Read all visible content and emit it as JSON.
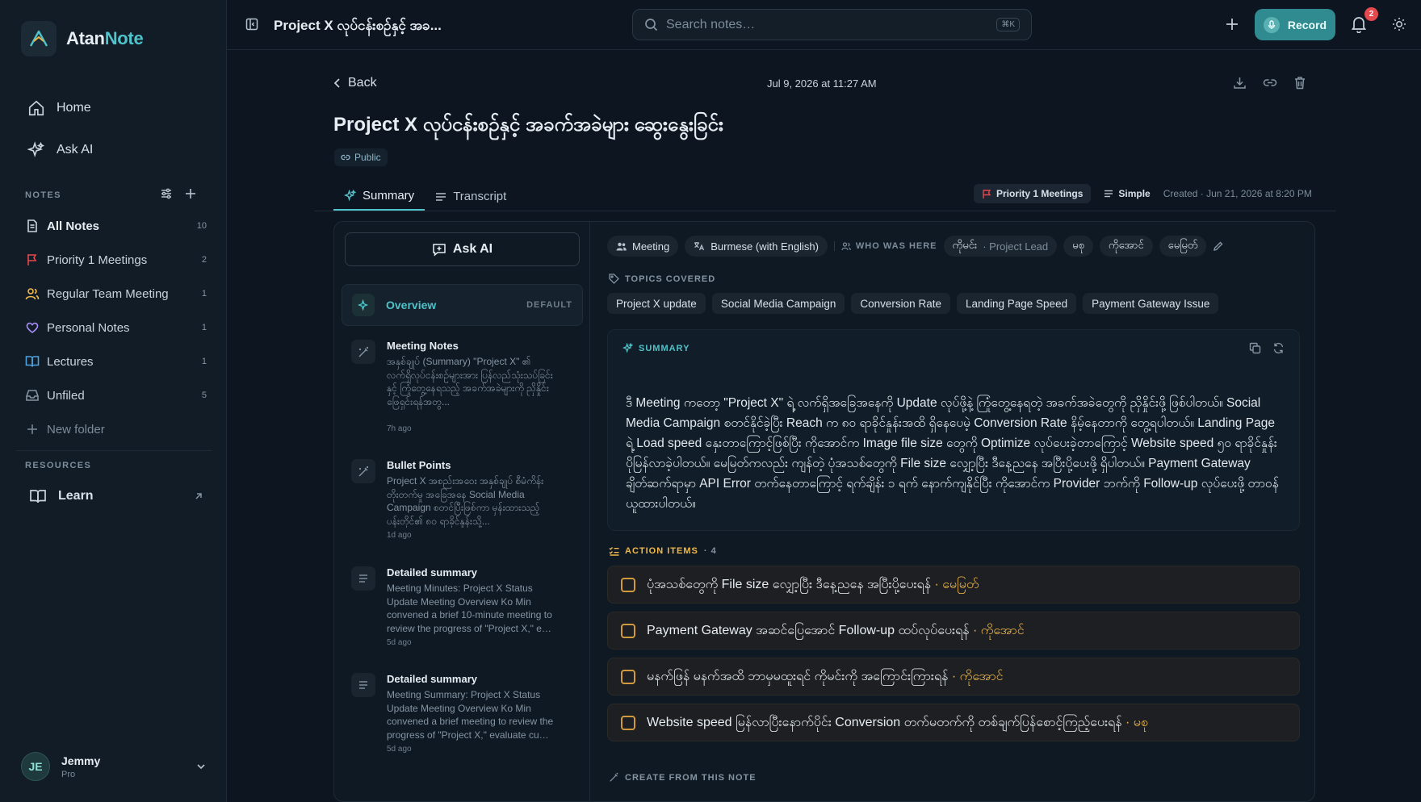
{
  "app": {
    "name_part1": "Atan",
    "name_part2": "Note"
  },
  "sidebar": {
    "nav": [
      {
        "label": "Home",
        "icon": "home-icon"
      },
      {
        "label": "Ask AI",
        "icon": "sparkle-icon"
      }
    ],
    "notes_label": "NOTES",
    "notes": [
      {
        "label": "All Notes",
        "count": "10",
        "icon": "document-icon",
        "color": "#c9d3dc"
      },
      {
        "label": "Priority 1 Meetings",
        "count": "2",
        "icon": "flag-icon",
        "color": "#e5484d"
      },
      {
        "label": "Regular Team Meeting",
        "count": "1",
        "icon": "users-icon",
        "color": "#f0b84a"
      },
      {
        "label": "Personal Notes",
        "count": "1",
        "icon": "heart-icon",
        "color": "#a78bfa"
      },
      {
        "label": "Lectures",
        "count": "1",
        "icon": "book-icon",
        "color": "#4fa3e0"
      },
      {
        "label": "Unfiled",
        "count": "5",
        "icon": "inbox-icon",
        "color": "#8594a3"
      }
    ],
    "new_folder": "New folder",
    "resources_label": "RESOURCES",
    "learn": "Learn",
    "user": {
      "initials": "JE",
      "name": "Jemmy",
      "plan": "Pro"
    }
  },
  "topbar": {
    "title": "Project X လုပ်ငန်းစဉ်နှင့် အခ...",
    "search_placeholder": "Search notes…",
    "search_shortcut": "⌘K",
    "record_label": "Record",
    "notifications_count": "2"
  },
  "note": {
    "back": "Back",
    "date": "Jul 9, 2026 at 11:27 AM",
    "title": "Project X လုပ်ငန်းစဉ်နှင့် အခက်အခဲများ ဆွေးနွေးခြင်း",
    "visibility": "Public",
    "tabs": [
      "Summary",
      "Transcript"
    ],
    "folder": "Priority 1 Meetings",
    "mode": "Simple",
    "created": "Created · Jun 21, 2026 at 8:20 PM"
  },
  "templates": {
    "ask_ai": "Ask AI",
    "overview": {
      "label": "Overview",
      "tag": "DEFAULT"
    },
    "items": [
      {
        "title": "Meeting Notes",
        "desc": "အနှစ်ချုပ် (Summary) \"Project X\" ၏ လက်ရှိလုပ်ငန်းစဉ်များအား ပြန်လည်သုံးသပ်ခြင်းနှင့် ကြုံတွေ့နေရသည့် အခက်အခဲများကို ညှိနှိုင်းဖြေရှင်းရန်အတွ...",
        "age": "7h ago"
      },
      {
        "title": "Bullet Points",
        "desc": "Project X အစည်းအဝေး အနှစ်ချုပ် စီမံကိန်းတိုးတက်မှု အခြေအနေ Social Media Campaign စတင်ပြီးဖြစ်ကာ မှန်းထားသည့်ပန်းတိုင်၏ ၈၀ ရာခိုင်နှုန်းသို့...",
        "age": "1d ago"
      },
      {
        "title": "Detailed summary",
        "desc": "Meeting Minutes: Project X Status Update Meeting Overview Ko Min convened a brief 10-minute meeting to review the progress of \"Project X,\" e…",
        "age": "5d ago"
      },
      {
        "title": "Detailed summary",
        "desc": "Meeting Summary: Project X Status Update Meeting Overview Ko Min convened a brief meeting to review the progress of \"Project X,\" evaluate cu…",
        "age": "5d ago"
      }
    ]
  },
  "details": {
    "type": "Meeting",
    "language": "Burmese (with English)",
    "who_label": "WHO WAS HERE",
    "participants": [
      {
        "name": "ကိုမင်း",
        "role": "· Project Lead"
      },
      {
        "name": "မစု",
        "role": ""
      },
      {
        "name": "ကိုအောင်",
        "role": ""
      },
      {
        "name": "မေမြတ်",
        "role": ""
      }
    ],
    "topics_label": "TOPICS COVERED",
    "topics": [
      "Project X update",
      "Social Media Campaign",
      "Conversion Rate",
      "Landing Page Speed",
      "Payment Gateway Issue"
    ]
  },
  "summary": {
    "label": "SUMMARY",
    "text": "ဒီ Meeting ကတော့ \"Project X\" ရဲ့ လက်ရှိအခြေအနေကို Update လုပ်ဖို့နဲ့ ကြုံတွေ့နေရတဲ့ အခက်အခဲတွေကို ညှိနှိုင်းဖို့ ဖြစ်ပါတယ်။ Social Media Campaign စတင်နိုင်ခဲ့ပြီး Reach က ၈၀ ရာခိုင်နှုန်းအထိ ရှိနေပေမဲ့ Conversion Rate နိမ့်နေတာကို တွေ့ရပါတယ်။ Landing Page ရဲ့ Load speed နှေးတာကြောင့်ဖြစ်ပြီး ကိုအောင်က Image file size တွေကို Optimize လုပ်ပေးခဲ့တာကြောင့် Website speed ၅၀ ရာခိုင်နှုန်း ပိုမြန်လာခဲ့ပါတယ်။ မေမြတ်ကလည်း ကျန်တဲ့ ပုံအသစ်တွေကို File size လျှော့ပြီး ဒီနေ့ညနေ အပြီးပို့ပေးဖို့ ရှိပါတယ်။ Payment Gateway ချိတ်ဆက်ရာမှာ API Error တက်နေတာကြောင့် ရက်ချိန်း ၁ ရက် နောက်ကျနိုင်ပြီး ကိုအောင်က Provider ဘက်ကို Follow-up လုပ်ပေးဖို့ တာဝန်ယူထားပါတယ်။"
  },
  "action_items": {
    "label": "ACTION ITEMS",
    "count": "· 4",
    "items": [
      {
        "text": "ပုံအသစ်တွေကို File size လျှော့ပြီး ဒီနေ့ညနေ အပြီးပို့ပေးရန်",
        "assignee": "· မေမြတ်"
      },
      {
        "text": "Payment Gateway အဆင်ပြေအောင် Follow-up ထပ်လုပ်ပေးရန်",
        "assignee": "· ကိုအောင်"
      },
      {
        "text": "မနက်ဖြန် မနက်အထိ ဘာမှမထူးရင် ကိုမင်းကို အကြောင်းကြားရန်",
        "assignee": "· ကိုအောင်"
      },
      {
        "text": "Website speed မြန်လာပြီးနောက်ပိုင်း Conversion တက်မတက်ကို တစ်ချက်ပြန်စောင့်ကြည့်ပေးရန်",
        "assignee": "· မစု"
      }
    ]
  },
  "create_label": "CREATE FROM THIS NOTE",
  "colors": {
    "accent": "#4fc3c9",
    "record": "#2f8b8f",
    "action": "#f0b84a",
    "badge": "#e5484d"
  }
}
